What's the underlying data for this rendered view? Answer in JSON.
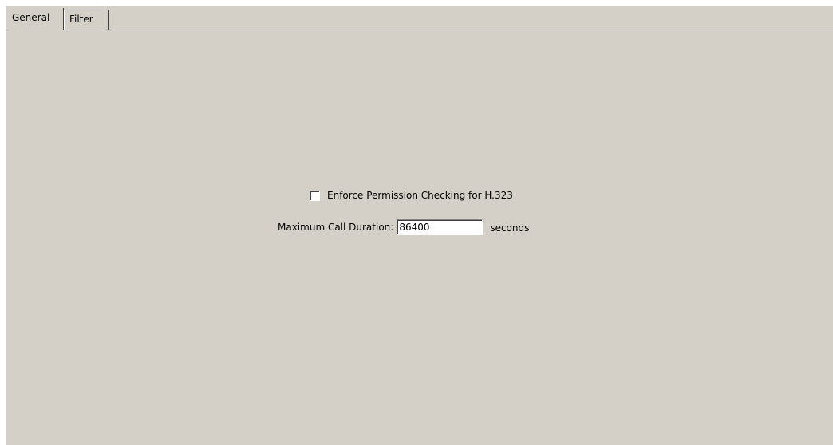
{
  "tabs": [
    {
      "label": "General",
      "active": true
    },
    {
      "label": "Filter",
      "active": false
    }
  ],
  "general": {
    "enforce_checkbox": {
      "label": "Enforce Permission Checking for H.323",
      "checked": false
    },
    "max_call_duration": {
      "label": "Maximum Call Duration:",
      "value": "86400",
      "unit": "seconds"
    }
  },
  "colors": {
    "panel_background": "#d4d0c8"
  }
}
